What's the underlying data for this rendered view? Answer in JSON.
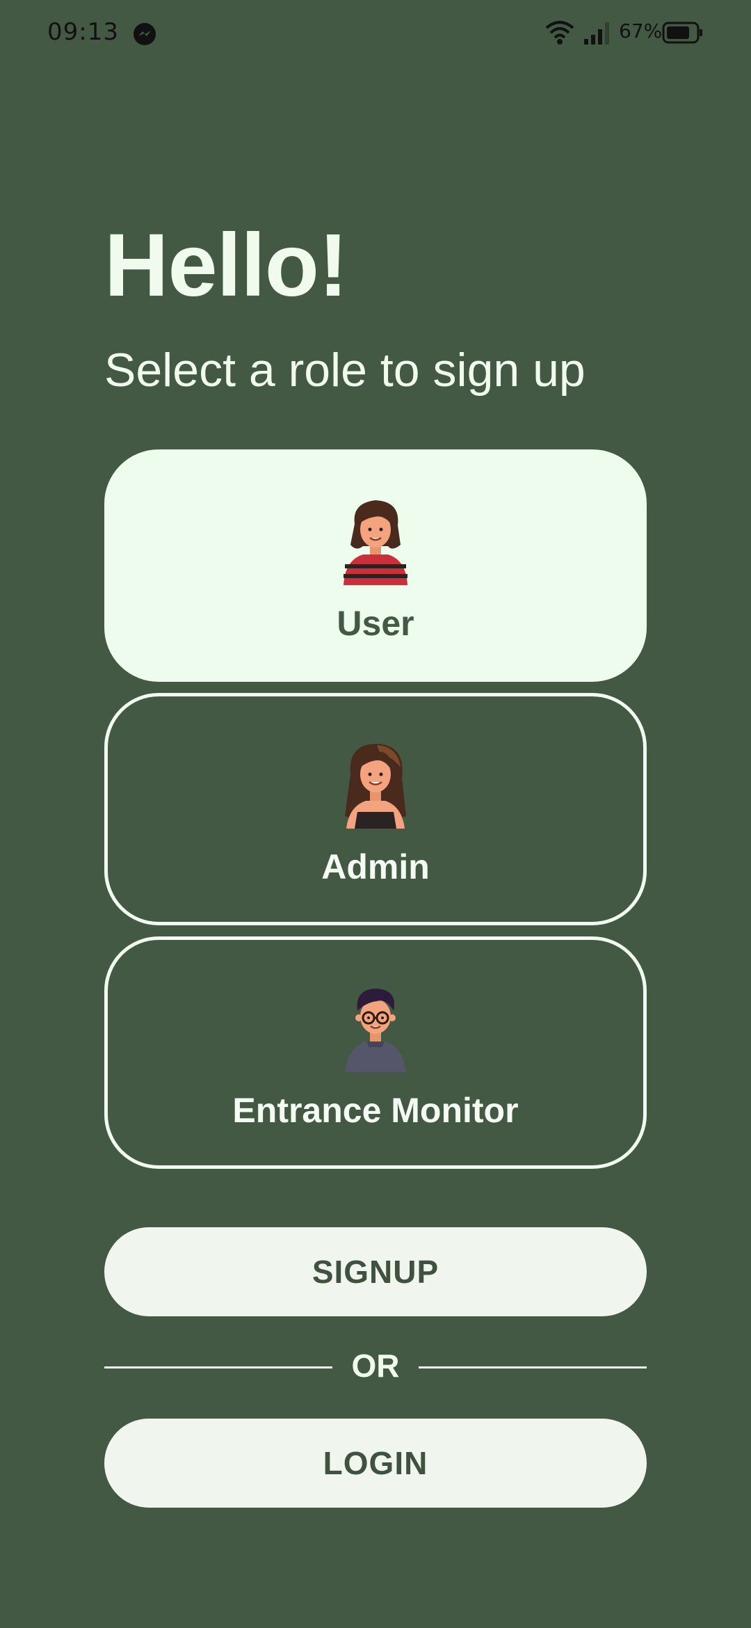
{
  "status_bar": {
    "time": "09:13",
    "battery": "67%"
  },
  "header": {
    "title": "Hello!",
    "subtitle": "Select a role to sign up"
  },
  "roles": [
    {
      "label": "User",
      "selected": true
    },
    {
      "label": "Admin",
      "selected": false
    },
    {
      "label": "Entrance Monitor",
      "selected": false
    }
  ],
  "actions": {
    "signup_label": "SIGNUP",
    "divider_label": "OR",
    "login_label": "LOGIN"
  },
  "colors": {
    "background": "#435943",
    "card_selected": "#edfcec",
    "button_bg": "#f0f5ee",
    "button_text": "#3f523f"
  }
}
